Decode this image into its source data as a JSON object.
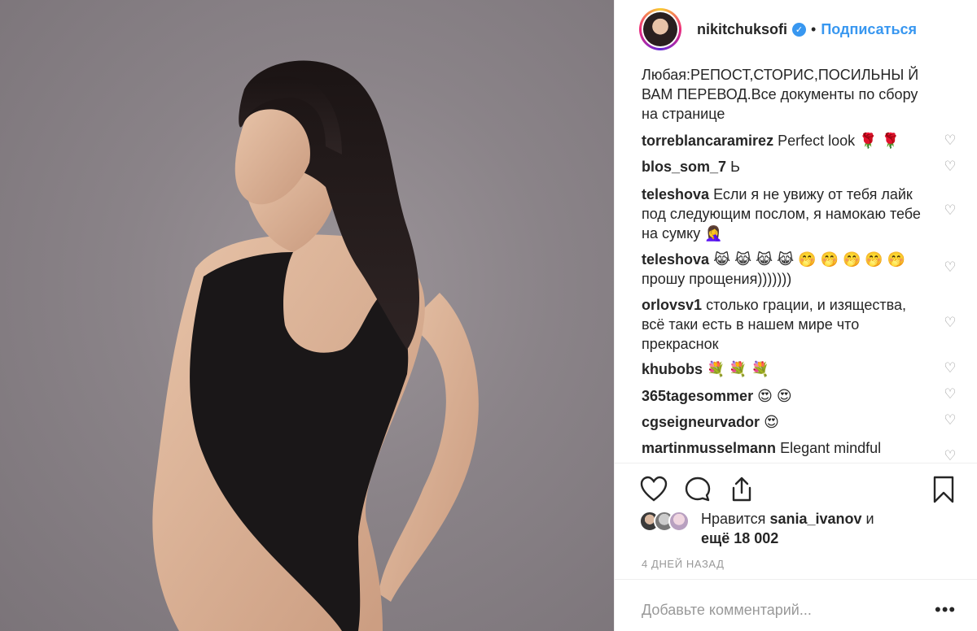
{
  "header": {
    "username": "nikitchuksofi",
    "dot": "•",
    "follow_label": "Подписаться"
  },
  "comments": [
    {
      "user": "",
      "text": "Любая:РЕПОСТ,СТОРИС,ПОСИЛЬНЫ Й ВАМ ПЕРЕВОД.Все документы по сбору на странице"
    },
    {
      "user": "torreblancaramirez",
      "text": "Perfect look 🌹 🌹"
    },
    {
      "user": "blos_som_7",
      "text": "Ь"
    },
    {
      "user": "teleshova",
      "text": "Если я не увижу от тебя лайк под следующим послом, я намокаю тебе на сумку 🤦‍♀️"
    },
    {
      "user": "teleshova",
      "text": "😹 😹 😹 😹 🤭 🤭 🤭 🤭 🤭 прошу прощения)))))))"
    },
    {
      "user": "orlovsv1",
      "text": "столько грации, и изящества, всё таки есть в нашем мире что прекраснок"
    },
    {
      "user": "khubobs",
      "text": "💐 💐 💐"
    },
    {
      "user": "365tagesommer",
      "text": "😍 😍"
    },
    {
      "user": "cgseigneurvador",
      "text": "😍"
    },
    {
      "user": "martinmusselmann",
      "text": "Elegant mindful"
    }
  ],
  "icons": {
    "like": "heart-outline",
    "comment": "speech-bubble",
    "share": "share-arrow",
    "save": "bookmark",
    "comment_like": "small-heart",
    "options": "ellipsis"
  },
  "likes": {
    "prefix": "Нравится",
    "user": "sania_ivanov",
    "suffix": "и",
    "others": "ещё 18 002"
  },
  "date": "4 ДНЕЙ НАЗАД",
  "add_comment": {
    "placeholder": "Добавьте комментарий...",
    "more": "•••"
  },
  "colors": {
    "accent_blue": "#3897f0",
    "annotation_pink": "#e66be0",
    "text": "#262626",
    "muted": "#999999"
  }
}
